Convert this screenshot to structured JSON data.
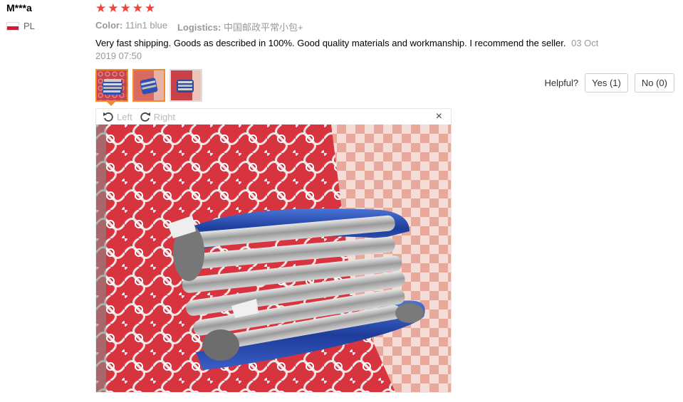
{
  "review": {
    "user_name": "M***a",
    "country": "PL",
    "rating": 5,
    "color_label": "Color:",
    "color_value": "11in1 blue",
    "logistics_label": "Logistics:",
    "logistics_value": "中国邮政平常小包+",
    "feedback_text": "Very fast shipping. Goods as described in 100%. Good quality materials and workmanship. I recommend the seller.",
    "date": "03 Oct 2019 07:50",
    "photo_count": 3,
    "active_photo": 1
  },
  "helpful": {
    "label": "Helpful?",
    "yes_label": "Yes (1)",
    "no_label": "No (0)"
  },
  "viewer": {
    "rotate_left_label": "Left",
    "rotate_right_label": "Right",
    "close_glyph": "×"
  },
  "colors": {
    "star": "#f44336",
    "active_border": "#f08c2d",
    "muted_text": "#999999"
  },
  "icons": [
    "flag-pl-icon",
    "star-icon",
    "rotate-left-icon",
    "rotate-right-icon",
    "close-icon"
  ]
}
